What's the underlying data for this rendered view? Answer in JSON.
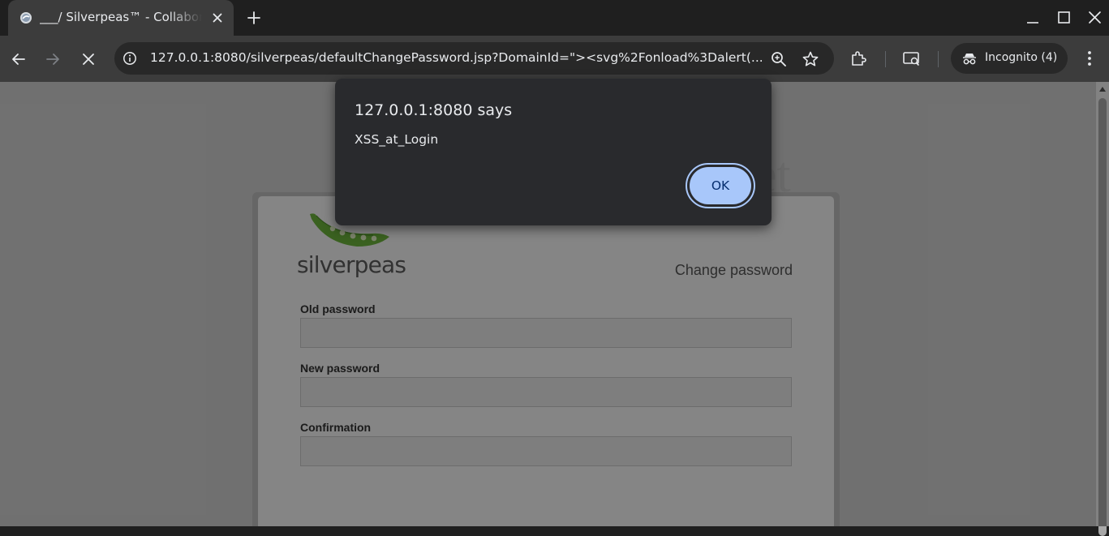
{
  "browser": {
    "tab": {
      "title": "___/ Silverpeas™ - Collaborative intranet"
    },
    "address_bar": {
      "url": "127.0.0.1:8080/silverpeas/defaultChangePassword.jsp?DomainId=\"><svg%2Fonload%3Dalert(..."
    },
    "profile": {
      "label": "Incognito (4)"
    },
    "colors": {
      "tab_bar": "#1f1f1f",
      "toolbar": "#3c3c3c",
      "omnibox": "#282828",
      "text": "#e8eaed"
    }
  },
  "page": {
    "background_brand": "et",
    "logo": {
      "text": "silverpeas"
    },
    "heading": "Change password",
    "fields": [
      {
        "label": "Old password",
        "value": ""
      },
      {
        "label": "New password",
        "value": ""
      },
      {
        "label": "Confirmation",
        "value": ""
      }
    ]
  },
  "dialog": {
    "title": "127.0.0.1:8080 says",
    "message": "XSS_at_Login",
    "ok_label": "OK",
    "colors": {
      "background": "#292a2d",
      "button": "#a8c7fa",
      "button_text": "#062e6f"
    }
  },
  "icons": {
    "tab_favicon": "silverpeas-favicon-icon",
    "tab_close": "close-icon",
    "new_tab": "plus-icon",
    "minimize": "minimize-icon",
    "maximize": "maximize-icon",
    "close_window": "close-icon",
    "back": "arrow-left-icon",
    "forward": "arrow-right-icon",
    "stop": "stop-loading-icon",
    "site_info": "info-icon",
    "zoom": "zoom-icon",
    "bookmark": "star-icon",
    "extensions": "puzzle-icon",
    "media": "media-control-icon",
    "incognito": "incognito-icon",
    "menu": "kebab-menu-icon"
  }
}
